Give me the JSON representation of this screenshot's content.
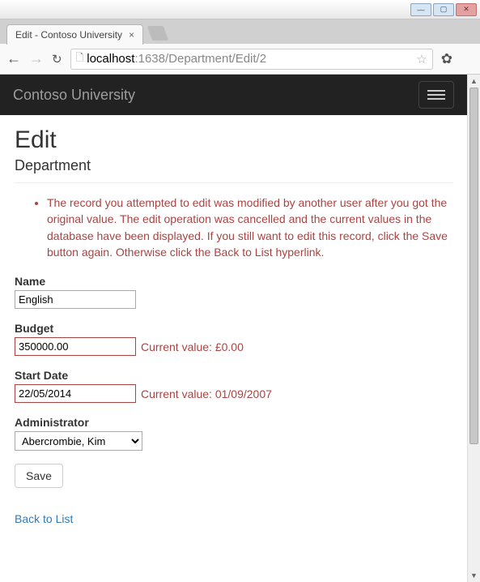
{
  "browser": {
    "tab_title": "Edit - Contoso University",
    "url_host": "localhost",
    "url_port": ":1638",
    "url_path": "/Department/Edit/2"
  },
  "navbar": {
    "brand": "Contoso University"
  },
  "page": {
    "title": "Edit",
    "subtitle": "Department"
  },
  "validation": {
    "messages": [
      "The record you attempted to edit was modified by another user after you got the original value. The edit operation was cancelled and the current values in the database have been displayed. If you still want to edit this record, click the Save button again. Otherwise click the Back to List hyperlink."
    ]
  },
  "form": {
    "name": {
      "label": "Name",
      "value": "English"
    },
    "budget": {
      "label": "Budget",
      "value": "350000.00",
      "error": "Current value: £0.00"
    },
    "start_date": {
      "label": "Start Date",
      "value": "22/05/2014",
      "error": "Current value: 01/09/2007"
    },
    "administrator": {
      "label": "Administrator",
      "selected": "Abercrombie, Kim"
    },
    "save_label": "Save",
    "back_label": "Back to List"
  }
}
